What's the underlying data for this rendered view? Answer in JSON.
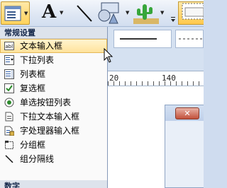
{
  "menu": {
    "section_common": "常规设置",
    "items": [
      {
        "label": "文本输入框",
        "icon": "text-field-icon",
        "highlighted": true
      },
      {
        "label": "下拉列表",
        "icon": "drop-down-list-icon",
        "highlighted": false
      },
      {
        "label": "列表框",
        "icon": "list-box-icon",
        "highlighted": false
      },
      {
        "label": "复选框",
        "icon": "checkbox-icon",
        "highlighted": false
      },
      {
        "label": "单选按钮列表",
        "icon": "radio-button-icon",
        "highlighted": false
      },
      {
        "label": "下拉文本输入框",
        "icon": "drop-down-text-field-icon",
        "highlighted": false
      },
      {
        "label": "字处理器输入框",
        "icon": "word-processor-field-icon",
        "highlighted": false
      },
      {
        "label": "分组框",
        "icon": "group-box-icon",
        "highlighted": false
      },
      {
        "label": "组分隔线",
        "icon": "group-separator-icon",
        "highlighted": false
      }
    ],
    "section_next": "数字"
  },
  "toolbar": {
    "text_glyph": "A",
    "buttons": [
      "form-field-icon",
      "text-icon",
      "line-icon",
      "shapes-icon",
      "picture-icon"
    ]
  },
  "ruler": {
    "marks": [
      "20",
      "140"
    ]
  },
  "inner_window": {
    "close_glyph": "✕"
  },
  "colors": {
    "highlight": "#ffe39c",
    "checkbox_check": "#2c8a2c",
    "radio": "#2c8a2c",
    "menu_header_bg": "#dde3ec"
  }
}
